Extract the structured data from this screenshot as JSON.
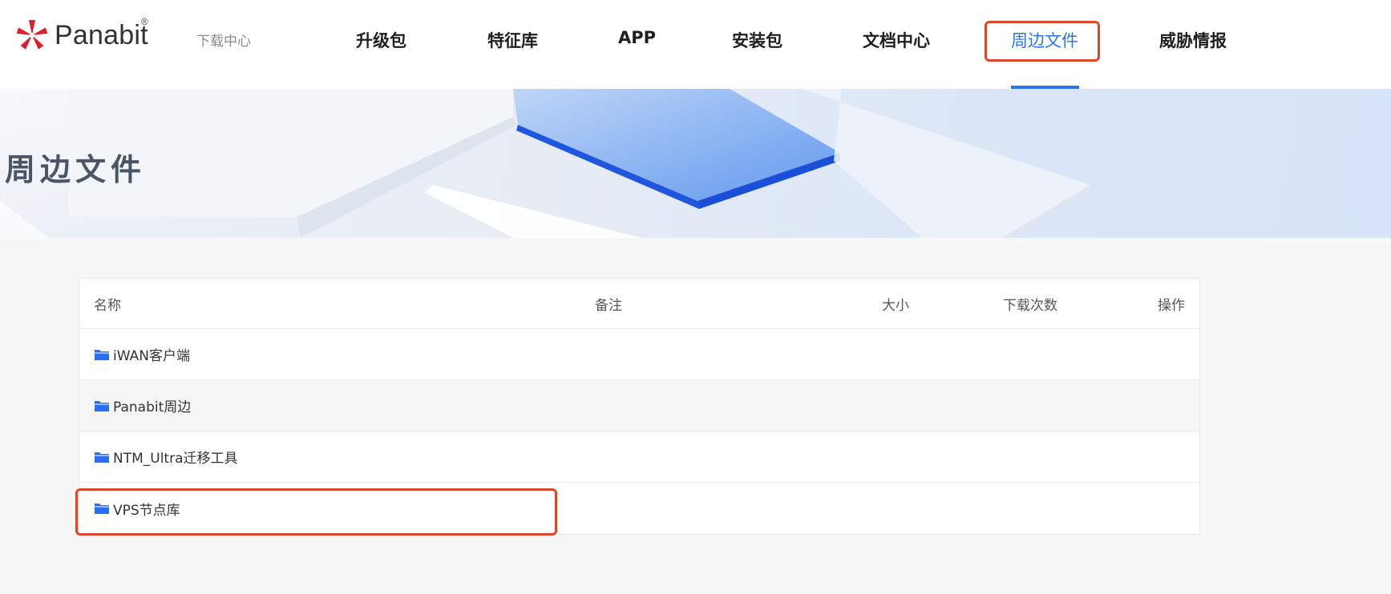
{
  "brand": {
    "name": "Panabit",
    "registered": "®",
    "subtitle": "下载中心"
  },
  "nav": {
    "items": [
      {
        "label": "升级包"
      },
      {
        "label": "特征库"
      },
      {
        "label": "APP"
      },
      {
        "label": "安装包"
      },
      {
        "label": "文档中心"
      },
      {
        "label": "周边文件",
        "active": true
      },
      {
        "label": "威胁情报"
      }
    ]
  },
  "banner": {
    "title": "周边文件"
  },
  "table": {
    "columns": {
      "name": "名称",
      "remark": "备注",
      "size": "大小",
      "downloads": "下载次数",
      "action": "操作"
    },
    "rows": [
      {
        "name": "iWAN客户端",
        "icon": "folder-icon"
      },
      {
        "name": "Panabit周边",
        "icon": "folder-icon"
      },
      {
        "name": "NTM_Ultra迁移工具",
        "icon": "folder-icon"
      },
      {
        "name": "VPS节点库",
        "icon": "folder-icon"
      }
    ]
  },
  "colors": {
    "accent": "#2a76e8",
    "highlight": "#e0452b",
    "logo_red": "#d8202f"
  }
}
